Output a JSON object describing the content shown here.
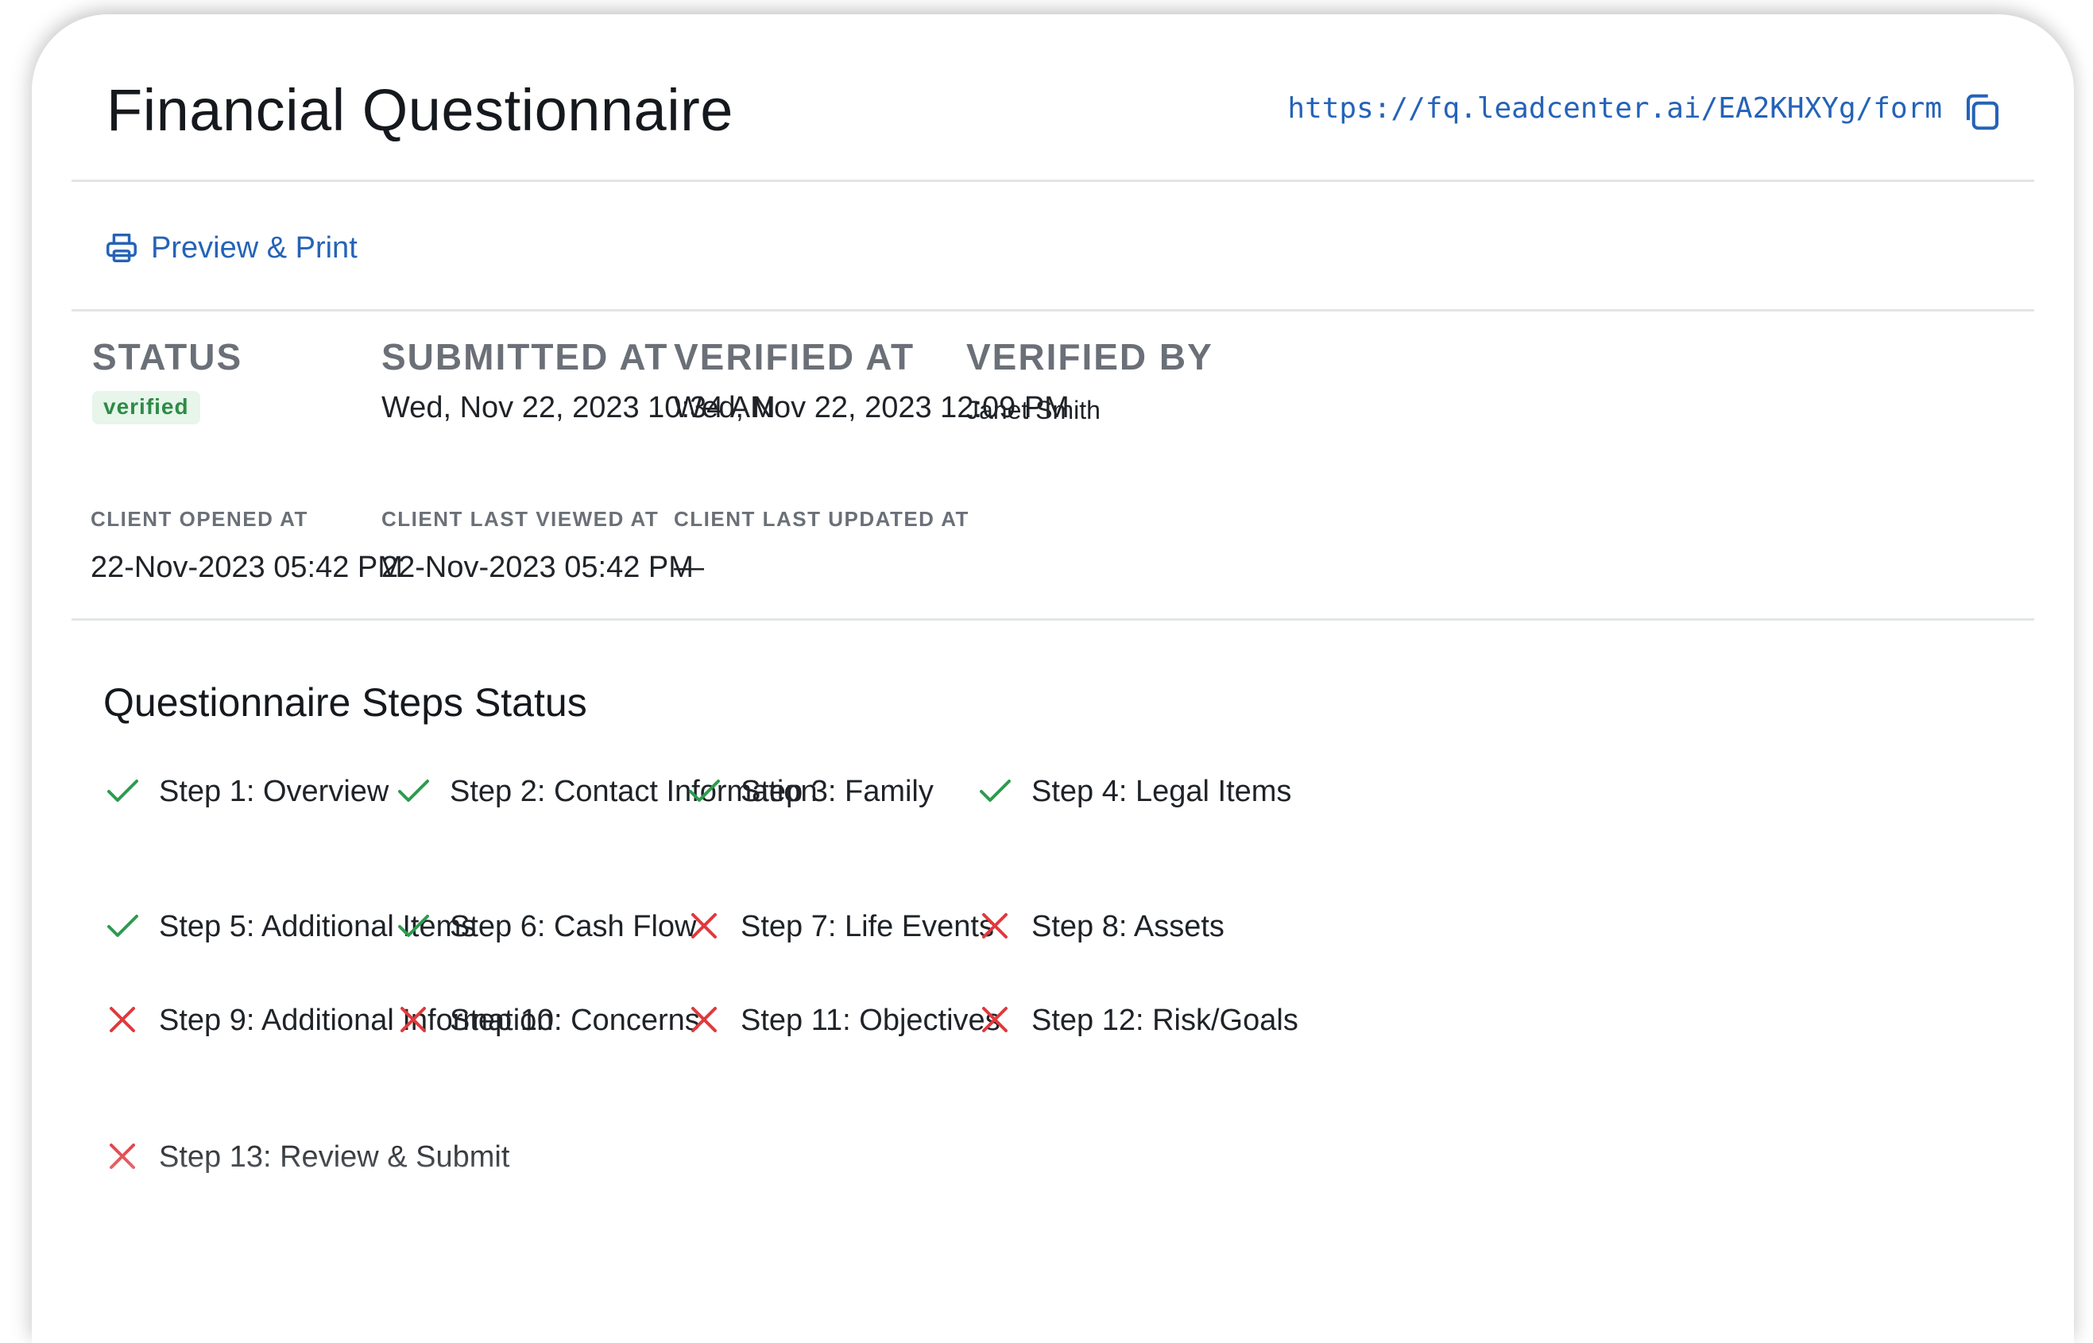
{
  "header": {
    "title": "Financial Questionnaire",
    "form_url": "https://fq.leadcenter.ai/EA2KHXYg/form",
    "copy_icon": "copy-icon"
  },
  "toolbar": {
    "preview_print_label": "Preview & Print",
    "print_icon": "printer-icon"
  },
  "meta": {
    "status": {
      "label": "STATUS",
      "value": "verified"
    },
    "submitted_at": {
      "label": "SUBMITTED AT",
      "value": "Wed, Nov 22, 2023 10:34 AM"
    },
    "verified_at": {
      "label": "VERIFIED AT",
      "value": "Wed, Nov 22, 2023 12:09 PM"
    },
    "verified_by": {
      "label": "VERIFIED BY",
      "value": "Janet Smith"
    },
    "client_opened_at": {
      "label": "CLIENT OPENED AT",
      "value": "22-Nov-2023 05:42 PM"
    },
    "client_last_viewed_at": {
      "label": "CLIENT LAST VIEWED AT",
      "value": "22-Nov-2023 05:42 PM"
    },
    "client_last_updated_at": {
      "label": "CLIENT LAST UPDATED AT",
      "value": "—"
    }
  },
  "steps_section": {
    "title": "Questionnaire Steps Status",
    "steps": [
      {
        "label": "Step 1: Overview",
        "complete": true
      },
      {
        "label": "Step 2: Contact Information",
        "complete": true
      },
      {
        "label": "Step 3: Family",
        "complete": true
      },
      {
        "label": "Step 4: Legal Items",
        "complete": true
      },
      {
        "label": "Step 5: Additional Items",
        "complete": true
      },
      {
        "label": "Step 6: Cash Flow",
        "complete": true
      },
      {
        "label": "Step 7: Life Events",
        "complete": false
      },
      {
        "label": "Step 8: Assets",
        "complete": false
      },
      {
        "label": "Step 9: Additional Information",
        "complete": false
      },
      {
        "label": "Step 10: Concerns",
        "complete": false
      },
      {
        "label": "Step 11: Objectives",
        "complete": false
      },
      {
        "label": "Step 12: Risk/Goals",
        "complete": false
      },
      {
        "label": "Step 13: Review & Submit",
        "complete": false
      }
    ]
  },
  "colors": {
    "link": "#2563b8",
    "complete": "#2e9b4f",
    "incomplete": "#e0393e",
    "badge_bg": "#e7f5ea",
    "badge_text": "#2e8b46"
  }
}
